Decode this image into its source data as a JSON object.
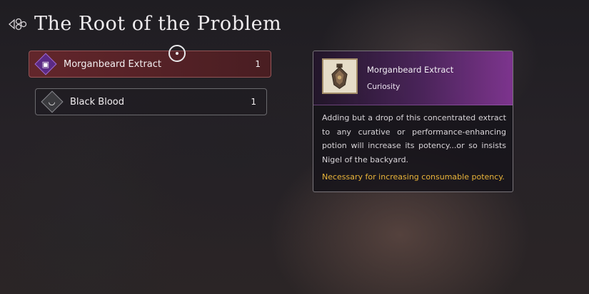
{
  "header": {
    "title": "The Root of the Problem",
    "icon": "quest-emblem-icon"
  },
  "items": [
    {
      "name": "Morganbeard Extract",
      "count": "1",
      "icon": "chest-icon",
      "selected": true
    },
    {
      "name": "Black Blood",
      "count": "1",
      "icon": "bowl-icon",
      "selected": false
    }
  ],
  "detail": {
    "name": "Morganbeard Extract",
    "category": "Curiosity",
    "description": "Adding but a drop of this concentrated extract to any curative or performance-enhancing potion will increase its potency...or so insists Nigel of the backyard.",
    "note": "Necessary for increasing consumable potency.",
    "note_color": "#e9b43a",
    "accent": "#5b2a84"
  }
}
